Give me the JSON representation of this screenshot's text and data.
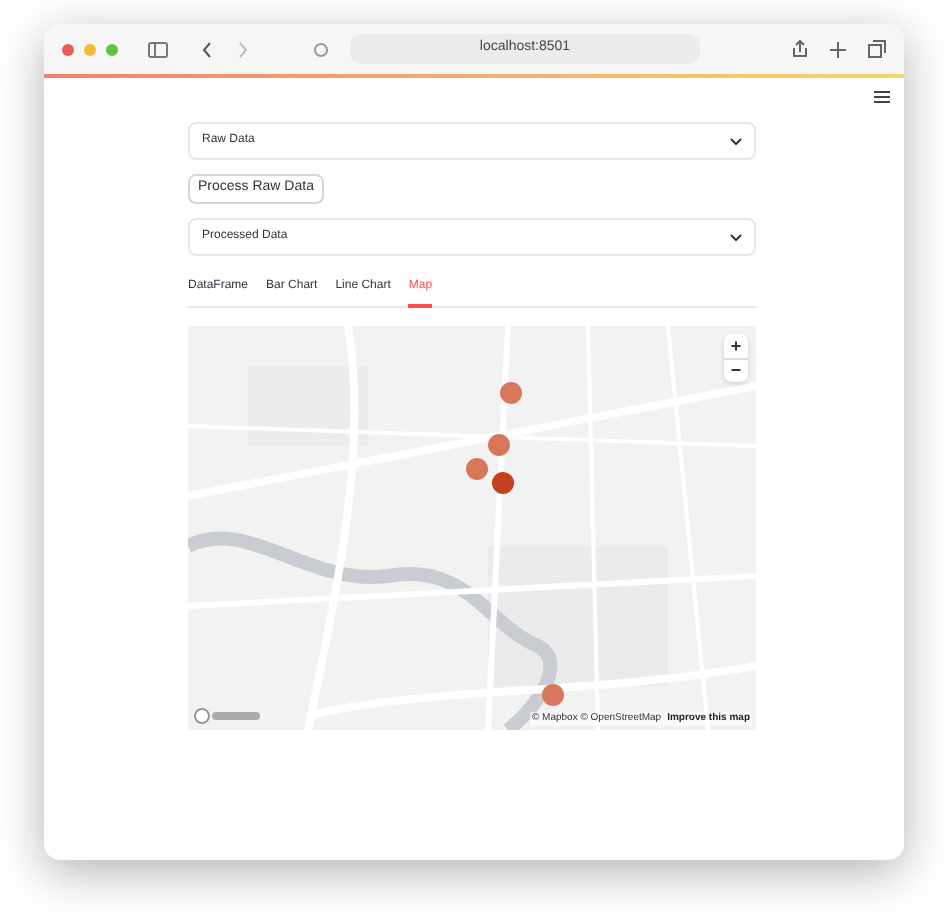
{
  "browser": {
    "address": "localhost:8501"
  },
  "expanders": [
    {
      "label": "Raw Data",
      "expanded": false
    },
    {
      "label": "Processed Data",
      "expanded": false
    }
  ],
  "button": "Process Raw Data",
  "tabs": [
    {
      "label": "DataFrame",
      "selected": false
    },
    {
      "label": "Bar Chart",
      "selected": false
    },
    {
      "label": "Line Chart",
      "selected": false
    },
    {
      "label": "Map",
      "selected": true
    }
  ],
  "map": {
    "zoom_in": "+",
    "zoom_out": "−",
    "attribution": "© Mapbox © OpenStreetMap",
    "improve_link": "Improve this map",
    "markers": [
      {
        "color": "#d9775c"
      },
      {
        "color": "#d9775c"
      },
      {
        "color": "#d9775c"
      },
      {
        "color": "#c4401f"
      },
      {
        "color": "#d9775c"
      }
    ]
  }
}
